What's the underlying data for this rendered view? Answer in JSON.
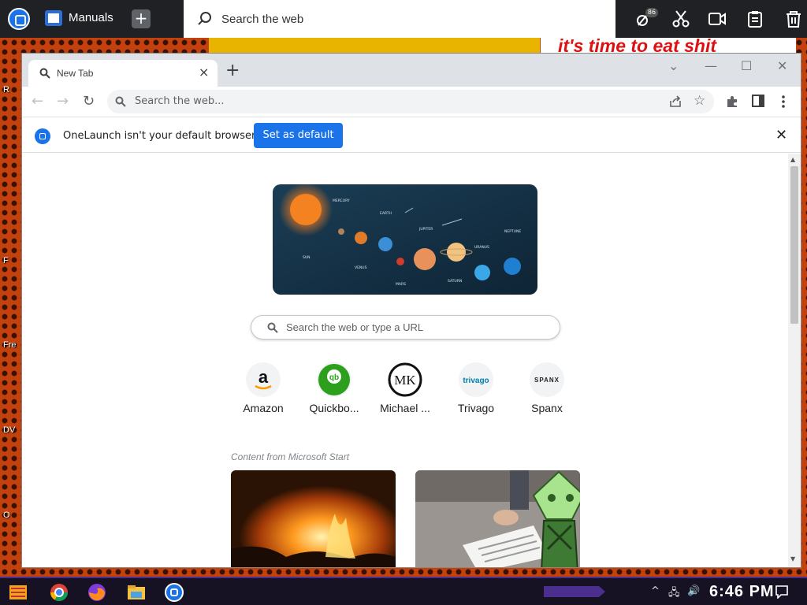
{
  "launcher": {
    "app_label": "Manuals",
    "search_placeholder": "Search the web",
    "notification_count": "86"
  },
  "wallpaper": {
    "meme_text": "it's time to eat shit"
  },
  "browser": {
    "tab_title": "New Tab",
    "omnibox_placeholder": "Search the web...",
    "infobar": {
      "message": "OneLaunch isn't your default browser",
      "button": "Set as default"
    },
    "page": {
      "search_placeholder": "Search the web or type a URL",
      "shortcuts": [
        {
          "label": "Amazon",
          "icon": "amazon-icon"
        },
        {
          "label": "Quickbo...",
          "icon": "quickbooks-icon"
        },
        {
          "label": "Michael ...",
          "icon": "michael-kors-icon"
        },
        {
          "label": "Trivago",
          "icon": "trivago-icon"
        },
        {
          "label": "Spanx",
          "icon": "spanx-icon"
        }
      ],
      "shortcut_logo_text": {
        "amazon": "a",
        "quickbooks": "qb",
        "michael_kors": "MK",
        "trivago": "trivago",
        "spanx": "SPANX"
      },
      "banner_labels": {
        "sun": "SUN",
        "mercury": "MERCURY",
        "venus": "VENUS",
        "earth": "EARTH",
        "mars": "MARS",
        "jupiter": "JUPITER",
        "saturn": "SATURN",
        "uranus": "URANUS",
        "neptune": "NEPTUNE"
      },
      "news_source": "Content from Microsoft Start"
    }
  },
  "taskbar": {
    "clock": "6:46 PM"
  },
  "colors": {
    "accent": "#1a73e8",
    "launcher_bg": "#202124",
    "wallpaper": "#c2410c"
  }
}
